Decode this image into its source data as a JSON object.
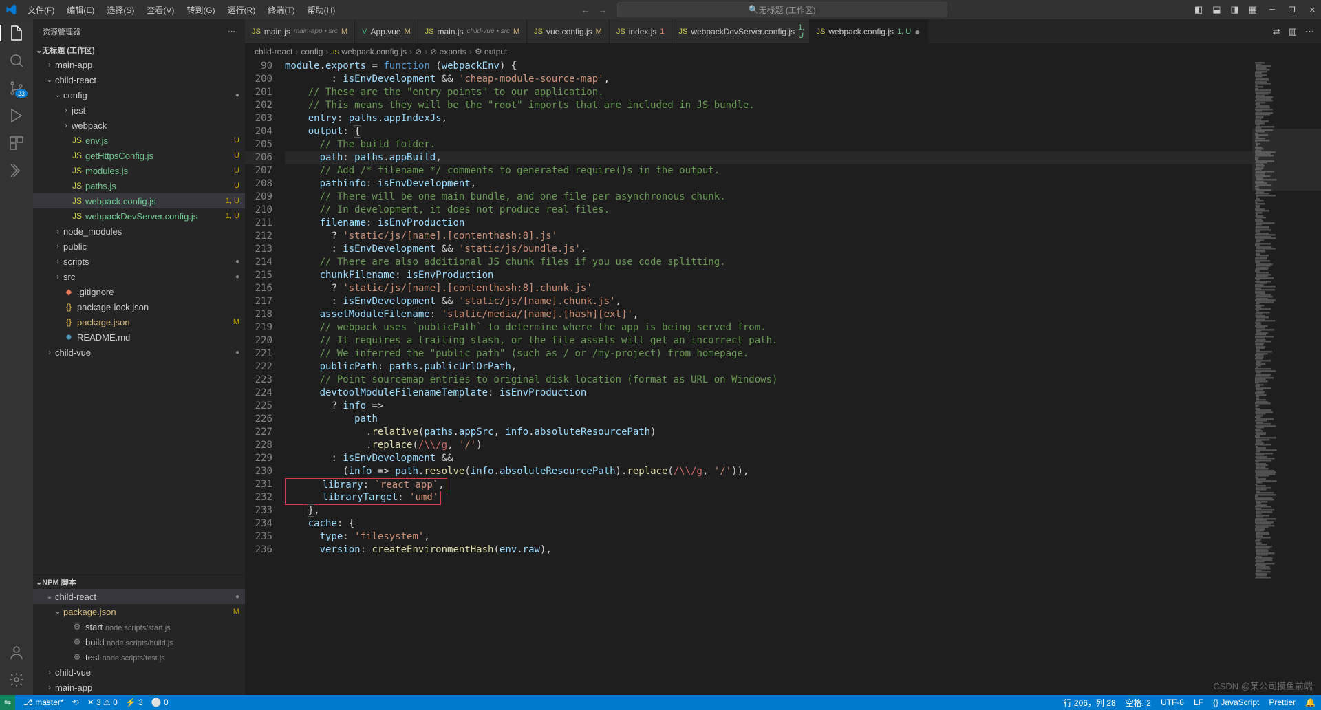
{
  "menu": [
    "文件(F)",
    "编辑(E)",
    "选择(S)",
    "查看(V)",
    "转到(G)",
    "运行(R)",
    "终端(T)",
    "帮助(H)"
  ],
  "searchTitle": "无标题 (工作区)",
  "scm_badge": "23",
  "sidebar": {
    "title": "资源管理器",
    "rootLabel": "无标题 (工作区)",
    "tree": [
      {
        "depth": 1,
        "icon": "chev-right",
        "label": "main-app",
        "type": "folder"
      },
      {
        "depth": 1,
        "icon": "chev-down",
        "label": "child-react",
        "type": "folder"
      },
      {
        "depth": 2,
        "icon": "chev-down",
        "label": "config",
        "type": "folder",
        "git": "●"
      },
      {
        "depth": 3,
        "icon": "chev-right",
        "label": "jest",
        "type": "folder"
      },
      {
        "depth": 3,
        "icon": "chev-right",
        "label": "webpack",
        "type": "folder"
      },
      {
        "depth": 3,
        "icon": "js",
        "label": "env.js",
        "type": "file",
        "status": "U",
        "class": "gitu"
      },
      {
        "depth": 3,
        "icon": "js",
        "label": "getHttpsConfig.js",
        "type": "file",
        "status": "U",
        "class": "gitu"
      },
      {
        "depth": 3,
        "icon": "js",
        "label": "modules.js",
        "type": "file",
        "status": "U",
        "class": "gitu"
      },
      {
        "depth": 3,
        "icon": "js",
        "label": "paths.js",
        "type": "file",
        "status": "U",
        "class": "gitu"
      },
      {
        "depth": 3,
        "icon": "js",
        "label": "webpack.config.js",
        "type": "file",
        "status": "1, U",
        "class": "gitu",
        "selected": true
      },
      {
        "depth": 3,
        "icon": "js",
        "label": "webpackDevServer.config.js",
        "type": "file",
        "status": "1, U",
        "class": "gitu"
      },
      {
        "depth": 2,
        "icon": "chev-right",
        "label": "node_modules",
        "type": "folder"
      },
      {
        "depth": 2,
        "icon": "chev-right",
        "label": "public",
        "type": "folder"
      },
      {
        "depth": 2,
        "icon": "chev-right",
        "label": "scripts",
        "type": "folder",
        "git": "●"
      },
      {
        "depth": 2,
        "icon": "chev-right",
        "label": "src",
        "type": "folder",
        "git": "●"
      },
      {
        "depth": 2,
        "icon": "gitignore",
        "label": ".gitignore",
        "type": "file"
      },
      {
        "depth": 2,
        "icon": "json",
        "label": "package-lock.json",
        "type": "file"
      },
      {
        "depth": 2,
        "icon": "json",
        "label": "package.json",
        "type": "file",
        "status": "M",
        "class": "gitm"
      },
      {
        "depth": 2,
        "icon": "md",
        "label": "README.md",
        "type": "file"
      },
      {
        "depth": 1,
        "icon": "chev-right",
        "label": "child-vue",
        "type": "folder",
        "git": "●"
      }
    ],
    "npm": {
      "title": "NPM 脚本",
      "items": [
        {
          "depth": 1,
          "icon": "chev-down",
          "label": "child-react",
          "git": "●",
          "selected": true
        },
        {
          "depth": 2,
          "icon": "chev-down",
          "label": "package.json",
          "iconcls": "json",
          "status": "M",
          "class": "gitm"
        },
        {
          "depth": 3,
          "icon": "script",
          "label": "start",
          "desc": "node scripts/start.js"
        },
        {
          "depth": 3,
          "icon": "script",
          "label": "build",
          "desc": "node scripts/build.js"
        },
        {
          "depth": 3,
          "icon": "script",
          "label": "test",
          "desc": "node scripts/test.js"
        },
        {
          "depth": 1,
          "icon": "chev-right",
          "label": "child-vue"
        },
        {
          "depth": 1,
          "icon": "chev-right",
          "label": "main-app"
        }
      ]
    }
  },
  "tabs": [
    {
      "icon": "js",
      "label": "main.js",
      "desc": "main-app • src",
      "badge": "M",
      "bclass": "m"
    },
    {
      "icon": "vue",
      "label": "App.vue",
      "badge": "M",
      "bclass": "m"
    },
    {
      "icon": "js",
      "label": "main.js",
      "desc": "child-vue • src",
      "badge": "M",
      "bclass": "m"
    },
    {
      "icon": "js",
      "label": "vue.config.js",
      "badge": "M",
      "bclass": "m"
    },
    {
      "icon": "js",
      "label": "index.js",
      "badge": "1",
      "bclass": "err"
    },
    {
      "icon": "js",
      "label": "webpackDevServer.config.js",
      "badge": "1, U",
      "bclass": "u"
    },
    {
      "icon": "js",
      "label": "webpack.config.js",
      "badge": "1, U",
      "bclass": "u",
      "active": true,
      "close": "●"
    }
  ],
  "breadcrumb": [
    "child-react",
    "config",
    "webpack.config.js",
    "<unknown>",
    "exports",
    "output"
  ],
  "code": {
    "startLine": 90,
    "lines": [
      {
        "n": 90,
        "html": "<span class='tk-ident'>module</span><span class='tk-punc'>.</span><span class='tk-ident'>exports</span> <span class='tk-punc'>=</span> <span class='tk-keyword'>function</span> <span class='tk-punc'>(</span><span class='tk-ident'>webpackEnv</span><span class='tk-punc'>) {</span>"
      },
      {
        "n": 200,
        "html": "        <span class='tk-punc'>:</span> <span class='tk-ident'>isEnvDevelopment</span> <span class='tk-punc'>&amp;&amp;</span> <span class='tk-string'>'cheap-module-source-map'</span><span class='tk-punc'>,</span>"
      },
      {
        "n": 201,
        "html": "    <span class='tk-comment'>// These are the \"entry points\" to our application.</span>"
      },
      {
        "n": 202,
        "html": "    <span class='tk-comment'>// This means they will be the \"root\" imports that are included in JS bundle.</span>"
      },
      {
        "n": 203,
        "html": "    <span class='tk-prop'>entry</span><span class='tk-punc'>:</span> <span class='tk-ident'>paths</span><span class='tk-punc'>.</span><span class='tk-ident'>appIndexJs</span><span class='tk-punc'>,</span>"
      },
      {
        "n": 204,
        "html": "    <span class='tk-prop'>output</span><span class='tk-punc'>:</span> <span class='tk-punc' style='outline:1px solid #555'>{</span>"
      },
      {
        "n": 205,
        "html": "      <span class='tk-comment'>// The build folder.</span>"
      },
      {
        "n": 206,
        "hl": true,
        "html": "      <span class='tk-prop'>path</span><span class='tk-punc'>:</span> <span class='tk-ident'>paths</span><span class='tk-punc'>.</span><span class='tk-ident'>appBuild</span><span class='tk-punc'>,</span>"
      },
      {
        "n": 207,
        "html": "      <span class='tk-comment'>// Add /* filename */ comments to generated require()s in the output.</span>"
      },
      {
        "n": 208,
        "html": "      <span class='tk-prop'>pathinfo</span><span class='tk-punc'>:</span> <span class='tk-ident'>isEnvDevelopment</span><span class='tk-punc'>,</span>"
      },
      {
        "n": 209,
        "html": "      <span class='tk-comment'>// There will be one main bundle, and one file per asynchronous chunk.</span>"
      },
      {
        "n": 210,
        "html": "      <span class='tk-comment'>// In development, it does not produce real files.</span>"
      },
      {
        "n": 211,
        "html": "      <span class='tk-prop'>filename</span><span class='tk-punc'>:</span> <span class='tk-ident'>isEnvProduction</span>"
      },
      {
        "n": 212,
        "html": "        <span class='tk-punc'>?</span> <span class='tk-string'>'static/js/[name].[contenthash:8].js'</span>"
      },
      {
        "n": 213,
        "html": "        <span class='tk-punc'>:</span> <span class='tk-ident'>isEnvDevelopment</span> <span class='tk-punc'>&amp;&amp;</span> <span class='tk-string'>'static/js/bundle.js'</span><span class='tk-punc'>,</span>"
      },
      {
        "n": 214,
        "html": "      <span class='tk-comment'>// There are also additional JS chunk files if you use code splitting.</span>"
      },
      {
        "n": 215,
        "html": "      <span class='tk-prop'>chunkFilename</span><span class='tk-punc'>:</span> <span class='tk-ident'>isEnvProduction</span>"
      },
      {
        "n": 216,
        "html": "        <span class='tk-punc'>?</span> <span class='tk-string'>'static/js/[name].[contenthash:8].chunk.js'</span>"
      },
      {
        "n": 217,
        "html": "        <span class='tk-punc'>:</span> <span class='tk-ident'>isEnvDevelopment</span> <span class='tk-punc'>&amp;&amp;</span> <span class='tk-string'>'static/js/[name].chunk.js'</span><span class='tk-punc'>,</span>"
      },
      {
        "n": 218,
        "html": "      <span class='tk-prop'>assetModuleFilename</span><span class='tk-punc'>:</span> <span class='tk-string'>'static/media/[name].[hash][ext]'</span><span class='tk-punc'>,</span>"
      },
      {
        "n": 219,
        "html": "      <span class='tk-comment'>// webpack uses `publicPath` to determine where the app is being served from.</span>"
      },
      {
        "n": 220,
        "html": "      <span class='tk-comment'>// It requires a trailing slash, or the file assets will get an incorrect path.</span>"
      },
      {
        "n": 221,
        "html": "      <span class='tk-comment'>// We inferred the \"public path\" (such as / or /my-project) from homepage.</span>"
      },
      {
        "n": 222,
        "html": "      <span class='tk-prop'>publicPath</span><span class='tk-punc'>:</span> <span class='tk-ident'>paths</span><span class='tk-punc'>.</span><span class='tk-ident'>publicUrlOrPath</span><span class='tk-punc'>,</span>"
      },
      {
        "n": 223,
        "html": "      <span class='tk-comment'>// Point sourcemap entries to original disk location (format as URL on Windows)</span>"
      },
      {
        "n": 224,
        "html": "      <span class='tk-prop'>devtoolModuleFilenameTemplate</span><span class='tk-punc'>:</span> <span class='tk-ident'>isEnvProduction</span>"
      },
      {
        "n": 225,
        "html": "        <span class='tk-punc'>?</span> <span class='tk-ident'>info</span> <span class='tk-punc'>=&gt;</span>"
      },
      {
        "n": 226,
        "html": "            <span class='tk-ident'>path</span>"
      },
      {
        "n": 227,
        "html": "              <span class='tk-punc'>.</span><span class='tk-func'>relative</span><span class='tk-punc'>(</span><span class='tk-ident'>paths</span><span class='tk-punc'>.</span><span class='tk-ident'>appSrc</span><span class='tk-punc'>,</span> <span class='tk-ident'>info</span><span class='tk-punc'>.</span><span class='tk-ident'>absoluteResourcePath</span><span class='tk-punc'>)</span>"
      },
      {
        "n": 228,
        "html": "              <span class='tk-punc'>.</span><span class='tk-func'>replace</span><span class='tk-punc'>(</span><span class='tk-regex'>/\\\\/g</span><span class='tk-punc'>,</span> <span class='tk-string'>'/'</span><span class='tk-punc'>)</span>"
      },
      {
        "n": 229,
        "html": "        <span class='tk-punc'>:</span> <span class='tk-ident'>isEnvDevelopment</span> <span class='tk-punc'>&amp;&amp;</span>"
      },
      {
        "n": 230,
        "html": "          <span class='tk-punc'>(</span><span class='tk-ident'>info</span> <span class='tk-punc'>=&gt;</span> <span class='tk-ident'>path</span><span class='tk-punc'>.</span><span class='tk-func'>resolve</span><span class='tk-punc'>(</span><span class='tk-ident'>info</span><span class='tk-punc'>.</span><span class='tk-ident'>absoluteResourcePath</span><span class='tk-punc'>).</span><span class='tk-func'>replace</span><span class='tk-punc'>(</span><span class='tk-regex'>/\\\\/g</span><span class='tk-punc'>,</span> <span class='tk-string'>'/'</span><span class='tk-punc'>)),</span>"
      },
      {
        "n": 231,
        "redbox": "start",
        "html": "      <span class='tk-prop'>library</span><span class='tk-punc'>:</span> <span class='tk-string'>`react app`</span><span class='tk-punc'>,</span>"
      },
      {
        "n": 232,
        "redbox": "end",
        "html": "      <span class='tk-prop'>libraryTarget</span><span class='tk-punc'>:</span> <span class='tk-string'>'umd'</span>"
      },
      {
        "n": 233,
        "html": "    <span class='tk-punc' style='outline:1px solid #555'>}</span><span class='tk-punc'>,</span>"
      },
      {
        "n": 234,
        "html": "    <span class='tk-prop'>cache</span><span class='tk-punc'>:</span> <span class='tk-punc'>{</span>"
      },
      {
        "n": 235,
        "html": "      <span class='tk-prop'>type</span><span class='tk-punc'>:</span> <span class='tk-string'>'filesystem'</span><span class='tk-punc'>,</span>"
      },
      {
        "n": 236,
        "html": "      <span class='tk-prop'>version</span><span class='tk-punc'>:</span> <span class='tk-func'>createEnvironmentHash</span><span class='tk-punc'>(</span><span class='tk-ident'>env</span><span class='tk-punc'>.</span><span class='tk-ident'>raw</span><span class='tk-punc'>),</span>"
      }
    ]
  },
  "statusbar": {
    "branch": "master*",
    "sync": "⟲",
    "errors": "✕ 3 ⚠ 0",
    "diag": "⚡ 3",
    "port": "⚪ 0",
    "cursor": "行 206，列 28",
    "spaces": "空格: 2",
    "encoding": "UTF-8",
    "eol": "LF",
    "lang": "{} JavaScript",
    "prettier": "Prettier",
    "bell": "🔔"
  },
  "watermark": "CSDN @某公司摸鱼前端"
}
